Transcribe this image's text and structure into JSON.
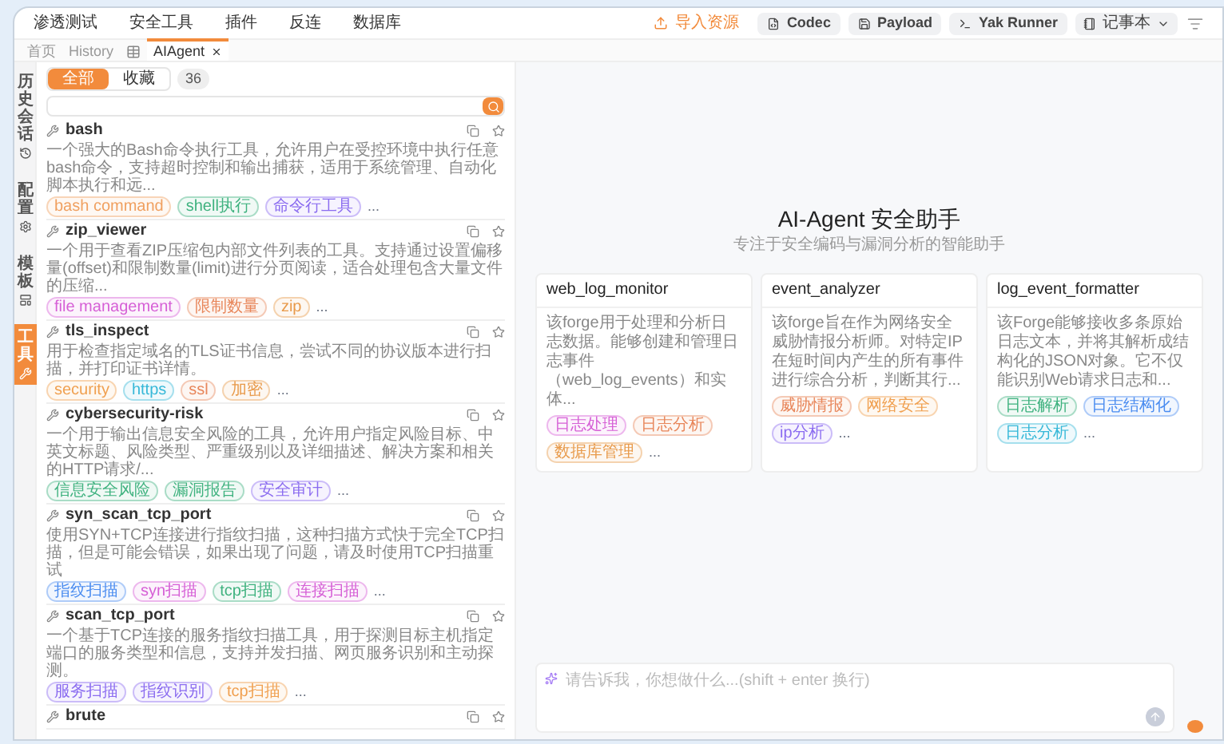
{
  "menu": [
    "渗透测试",
    "安全工具",
    "插件",
    "反连",
    "数据库"
  ],
  "toolbar": [
    {
      "label": "导入资源",
      "kind": "import"
    },
    {
      "label": "Codec",
      "kind": "tool"
    },
    {
      "label": "Payload",
      "kind": "tool"
    },
    {
      "label": "Yak Runner",
      "kind": "tool"
    },
    {
      "label": "记事本",
      "kind": "dropdown"
    }
  ],
  "tabs": [
    {
      "kind": "text",
      "label": "首页",
      "selected": false
    },
    {
      "kind": "text",
      "label": "History",
      "selected": false
    },
    {
      "kind": "icon",
      "selected": false
    },
    {
      "kind": "text",
      "label": "AIAgent",
      "selected": true
    }
  ],
  "side_tabs": [
    {
      "label": "历史会话",
      "selected": false
    },
    {
      "label": "配置",
      "selected": false
    },
    {
      "label": "模板",
      "selected": false
    },
    {
      "label": "工具",
      "selected": true
    }
  ],
  "filter": {
    "options": [
      {
        "label": "全部",
        "selected": true
      },
      {
        "label": "收藏",
        "selected": false
      }
    ],
    "count": "36"
  },
  "tools": [
    {
      "name": "bash",
      "description": "一个强大的Bash命令执行工具，允许用户在受控环境中执行任意bash命令，支持超时控制和输出捕获，适用于系统管理、自动化脚本执行和远...",
      "tags": [
        {
          "label": "bash command",
          "color": "#f0a060"
        },
        {
          "label": "shell执行",
          "color": "#3fb27f"
        },
        {
          "label": "命令行工具",
          "color": "#8b6cf0"
        }
      ],
      "more": "..."
    },
    {
      "name": "zip_viewer",
      "description": "一个用于查看ZIP压缩包内部文件列表的工具。支持通过设置偏移量(offset)和限制数量(limit)进行分页阅读，适合处理包含大量文件的压缩...",
      "tags": [
        {
          "label": "file management",
          "color": "#d660d6"
        },
        {
          "label": "限制数量",
          "color": "#e8865a"
        },
        {
          "label": "zip",
          "color": "#e89a4a"
        }
      ],
      "more": "..."
    },
    {
      "name": "tls_inspect",
      "description": "用于检查指定域名的TLS证书信息，尝试不同的协议版本进行扫描，并打印证书详情。",
      "tags": [
        {
          "label": "security",
          "color": "#f0a050"
        },
        {
          "label": "https",
          "color": "#36b8d8"
        },
        {
          "label": "ssl",
          "color": "#e8865a"
        },
        {
          "label": "加密",
          "color": "#e89a4a"
        }
      ],
      "more": "..."
    },
    {
      "name": "cybersecurity-risk",
      "description": "一个用于输出信息安全风险的工具，允许用户指定风险目标、中英文标题、风险类型、严重级别以及详细描述、解决方案和相关的HTTP请求/...",
      "tags": [
        {
          "label": "信息安全风险",
          "color": "#3fb27f"
        },
        {
          "label": "漏洞报告",
          "color": "#3fb27f"
        },
        {
          "label": "安全审计",
          "color": "#8b6cf0"
        }
      ],
      "more": "..."
    },
    {
      "name": "syn_scan_tcp_port",
      "description": "使用SYN+TCP连接进行指纹扫描，这种扫描方式快于完全TCP扫描，但是可能会错误，如果出现了问题，请及时使用TCP扫描重试",
      "tags": [
        {
          "label": "指纹扫描",
          "color": "#4a8cf0"
        },
        {
          "label": "syn扫描",
          "color": "#d660d6"
        },
        {
          "label": "tcp扫描",
          "color": "#3fb27f"
        },
        {
          "label": "连接扫描",
          "color": "#d660d6"
        }
      ],
      "more": "..."
    },
    {
      "name": "scan_tcp_port",
      "description": "一个基于TCP连接的服务指纹扫描工具，用于探测目标主机指定端口的服务类型和信息，支持并发扫描、网页服务识别和主动探测。",
      "tags": [
        {
          "label": "服务扫描",
          "color": "#8b6cf0"
        },
        {
          "label": "指纹识别",
          "color": "#8b6cf0"
        },
        {
          "label": "tcp扫描",
          "color": "#f0a050"
        }
      ],
      "more": "..."
    },
    {
      "name": "brute"
    }
  ],
  "assistant": {
    "title": "AI-Agent 安全助手",
    "subtitle": "专注于安全编码与漏洞分析的智能助手",
    "cards": [
      {
        "name": "web_log_monitor",
        "description": "该forge用于处理和分析日志数据。能够创建和管理日志事件（web_log_events）和实体...",
        "tags": [
          {
            "label": "日志处理",
            "color": "#d660d6"
          },
          {
            "label": "日志分析",
            "color": "#e8865a"
          },
          {
            "label": "数据库管理",
            "color": "#e89a4a"
          }
        ],
        "more": "..."
      },
      {
        "name": "event_analyzer",
        "description": "该forge旨在作为网络安全威胁情报分析师。对特定IP在短时间内产生的所有事件进行综合分析，判断其行...",
        "tags": [
          {
            "label": "威胁情报",
            "color": "#e8865a"
          },
          {
            "label": "网络安全",
            "color": "#f0a050"
          },
          {
            "label": "ip分析",
            "color": "#8b6cf0"
          }
        ],
        "more": "..."
      },
      {
        "name": "log_event_formatter",
        "description": "该Forge能够接收多条原始日志文本，并将其解析成结构化的JSON对象。它不仅能识别Web请求日志和...",
        "tags": [
          {
            "label": "日志解析",
            "color": "#3fb27f"
          },
          {
            "label": "日志结构化",
            "color": "#4a8cf0"
          },
          {
            "label": "日志分析",
            "color": "#36b8d8"
          }
        ],
        "more": "..."
      }
    ]
  },
  "input": {
    "placeholder": "请告诉我，你想做什么...(shift + enter 换行)"
  }
}
